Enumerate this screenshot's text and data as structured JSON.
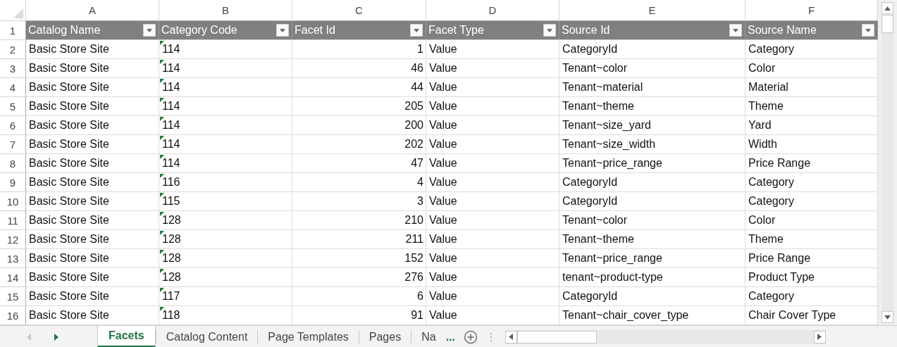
{
  "columns": [
    {
      "letter": "A",
      "header": "Catalog Name",
      "kind": "text",
      "number_stored_as_text": false
    },
    {
      "letter": "B",
      "header": "Category Code",
      "kind": "text",
      "number_stored_as_text": true
    },
    {
      "letter": "C",
      "header": "Facet Id",
      "kind": "number",
      "number_stored_as_text": false
    },
    {
      "letter": "D",
      "header": "Facet Type",
      "kind": "text",
      "number_stored_as_text": false
    },
    {
      "letter": "E",
      "header": "Source Id",
      "kind": "text",
      "number_stored_as_text": false
    },
    {
      "letter": "F",
      "header": "Source Name",
      "kind": "text",
      "number_stored_as_text": false
    }
  ],
  "header_row_number": "1",
  "rows": [
    {
      "number": "2",
      "cells": [
        "Basic Store Site",
        "114",
        "1",
        "Value",
        "CategoryId",
        "Category"
      ]
    },
    {
      "number": "3",
      "cells": [
        "Basic Store Site",
        "114",
        "46",
        "Value",
        "Tenant~color",
        "Color"
      ]
    },
    {
      "number": "4",
      "cells": [
        "Basic Store Site",
        "114",
        "44",
        "Value",
        "Tenant~material",
        "Material"
      ]
    },
    {
      "number": "5",
      "cells": [
        "Basic Store Site",
        "114",
        "205",
        "Value",
        "Tenant~theme",
        "Theme"
      ]
    },
    {
      "number": "6",
      "cells": [
        "Basic Store Site",
        "114",
        "200",
        "Value",
        "Tenant~size_yard",
        "Yard"
      ]
    },
    {
      "number": "7",
      "cells": [
        "Basic Store Site",
        "114",
        "202",
        "Value",
        "Tenant~size_width",
        "Width"
      ]
    },
    {
      "number": "8",
      "cells": [
        "Basic Store Site",
        "114",
        "47",
        "Value",
        "Tenant~price_range",
        "Price Range"
      ]
    },
    {
      "number": "9",
      "cells": [
        "Basic Store Site",
        "116",
        "4",
        "Value",
        "CategoryId",
        "Category"
      ]
    },
    {
      "number": "10",
      "cells": [
        "Basic Store Site",
        "115",
        "3",
        "Value",
        "CategoryId",
        "Category"
      ]
    },
    {
      "number": "11",
      "cells": [
        "Basic Store Site",
        "128",
        "210",
        "Value",
        "Tenant~color",
        "Color"
      ]
    },
    {
      "number": "12",
      "cells": [
        "Basic Store Site",
        "128",
        "211",
        "Value",
        "Tenant~theme",
        "Theme"
      ]
    },
    {
      "number": "13",
      "cells": [
        "Basic Store Site",
        "128",
        "152",
        "Value",
        "Tenant~price_range",
        "Price Range"
      ]
    },
    {
      "number": "14",
      "cells": [
        "Basic Store Site",
        "128",
        "276",
        "Value",
        "tenant~product-type",
        "Product Type"
      ]
    },
    {
      "number": "15",
      "cells": [
        "Basic Store Site",
        "117",
        "6",
        "Value",
        "CategoryId",
        "Category"
      ]
    },
    {
      "number": "16",
      "cells": [
        "Basic Store Site",
        "118",
        "91",
        "Value",
        "Tenant~chair_cover_type",
        "Chair Cover Type"
      ]
    }
  ],
  "sheet_tabs": [
    {
      "label": "Facets",
      "selected": true
    },
    {
      "label": "Catalog Content",
      "selected": false
    },
    {
      "label": "Page Templates",
      "selected": false
    },
    {
      "label": "Pages",
      "selected": false
    },
    {
      "label": "Na",
      "selected": false
    }
  ],
  "more_tabs": "..."
}
